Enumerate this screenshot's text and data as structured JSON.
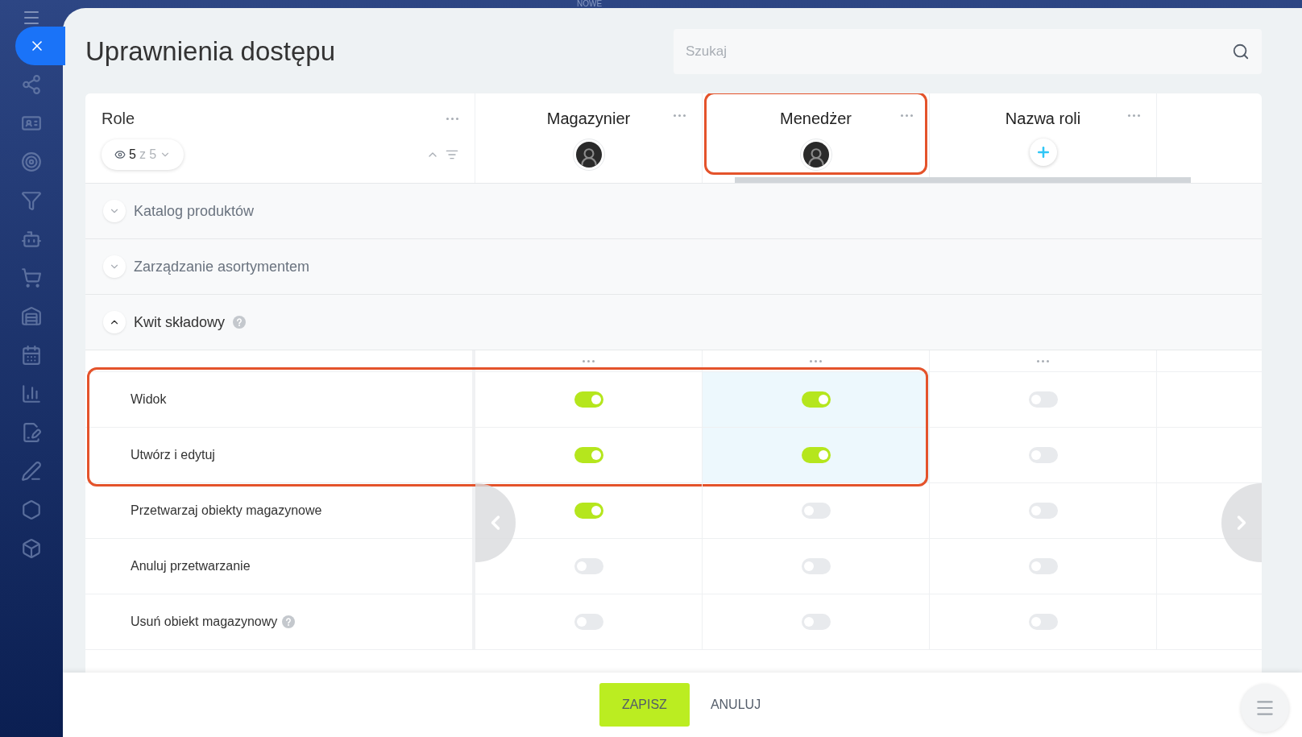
{
  "top_label": "NOWE",
  "title": "Uprawnienia dostępu",
  "search": {
    "placeholder": "Szukaj"
  },
  "roles_header": {
    "label": "Role",
    "visible": "5",
    "of": "z 5"
  },
  "roles": [
    {
      "name": "Magazynier",
      "kind": "avatar",
      "highlighted": false
    },
    {
      "name": "Menedżer",
      "kind": "avatar",
      "highlighted": true
    },
    {
      "name": "Nazwa roli",
      "kind": "add",
      "highlighted": false
    }
  ],
  "sections": [
    {
      "title": "Katalog produktów",
      "expanded": false,
      "help": false
    },
    {
      "title": "Zarządzanie asortymentem",
      "expanded": false,
      "help": false
    },
    {
      "title": "Kwit składowy",
      "expanded": true,
      "help": true
    }
  ],
  "permissions": [
    {
      "label": "Widok",
      "help": false,
      "highlighted": true,
      "cells": [
        {
          "on": true
        },
        {
          "on": true
        },
        {
          "on": false
        }
      ]
    },
    {
      "label": "Utwórz i edytuj",
      "help": false,
      "highlighted": true,
      "cells": [
        {
          "on": true
        },
        {
          "on": true
        },
        {
          "on": false
        }
      ]
    },
    {
      "label": "Przetwarzaj obiekty magazynowe",
      "help": false,
      "highlighted": false,
      "cells": [
        {
          "on": true
        },
        {
          "on": false
        },
        {
          "on": false
        }
      ]
    },
    {
      "label": "Anuluj przetwarzanie",
      "help": false,
      "highlighted": false,
      "cells": [
        {
          "on": false
        },
        {
          "on": false
        },
        {
          "on": false
        }
      ]
    },
    {
      "label": "Usuń obiekt magazynowy",
      "help": true,
      "highlighted": false,
      "cells": [
        {
          "on": false
        },
        {
          "on": false
        },
        {
          "on": false
        }
      ]
    }
  ],
  "buttons": [
    {
      "label": "ZAPISZ",
      "kind": "primary"
    },
    {
      "label": "ANULUJ",
      "kind": "link"
    }
  ]
}
